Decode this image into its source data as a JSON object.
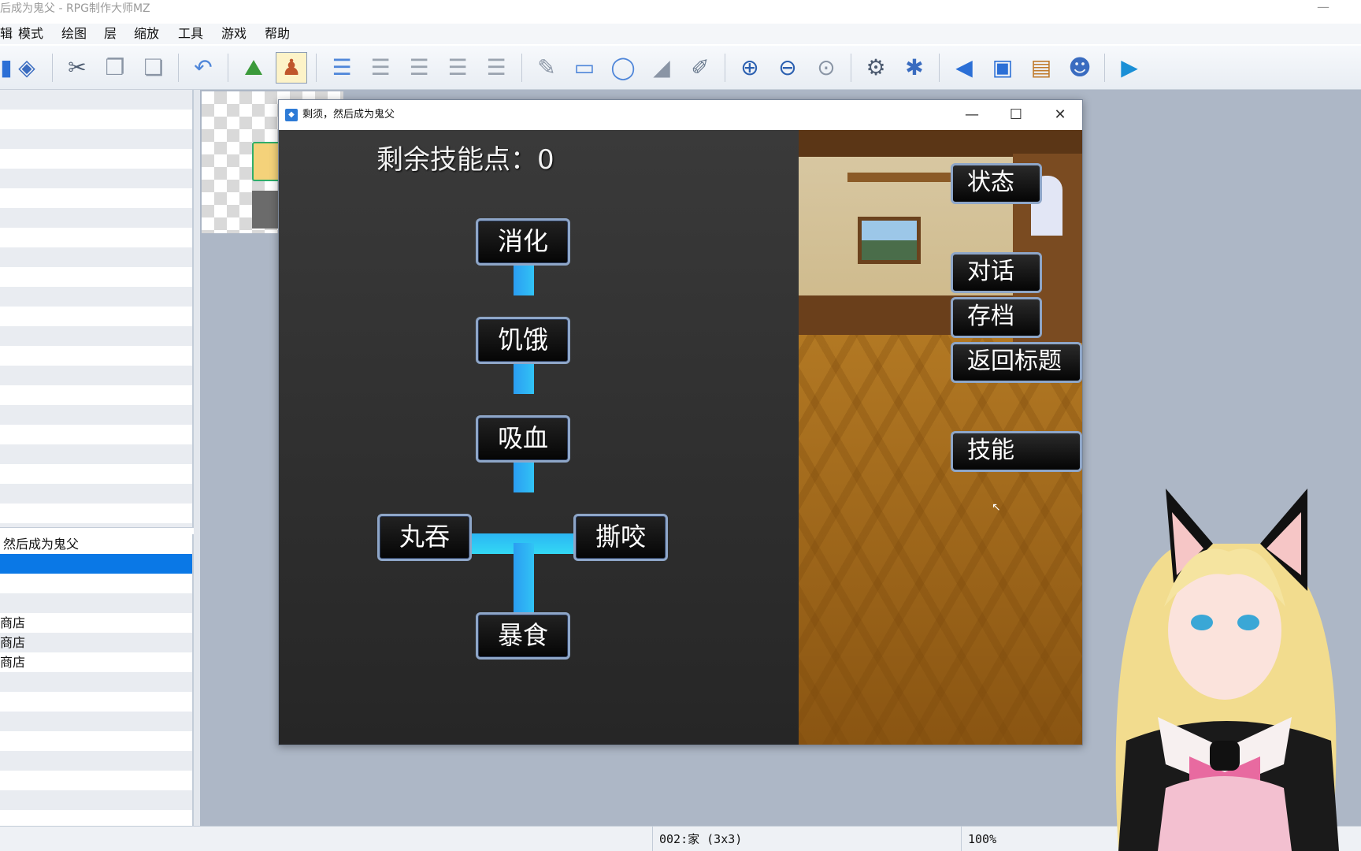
{
  "app": {
    "title": "后成为鬼父 - RPG制作大师MZ",
    "minimize_glyph": "—"
  },
  "menubar": {
    "items": [
      {
        "label": "辑"
      },
      {
        "label": "模式"
      },
      {
        "label": "绘图"
      },
      {
        "label": "层"
      },
      {
        "label": "缩放"
      },
      {
        "label": "工具"
      },
      {
        "label": "游戏"
      },
      {
        "label": "帮助"
      }
    ]
  },
  "toolbar": {
    "icons": [
      "save-icon",
      "deploy-icon",
      "cut-icon",
      "copy-icon",
      "paste-icon",
      "undo-icon",
      "map-mode-icon",
      "event-mode-icon",
      "layer-auto-icon",
      "layer-1-icon",
      "layer-2-icon",
      "layer-3-icon",
      "layer-4-icon",
      "pencil-icon",
      "rectangle-icon",
      "ellipse-icon",
      "fill-icon",
      "shadow-pen-icon",
      "zoom-in-icon",
      "zoom-out-icon",
      "zoom-actual-icon",
      "database-icon",
      "plugin-manager-icon",
      "sound-test-icon",
      "event-searcher-icon",
      "resource-manager-icon",
      "character-generator-icon",
      "playtest-icon"
    ]
  },
  "map_tree": {
    "project_label": "然后成为鬼父",
    "entries": [
      "商店",
      "商店",
      "商店"
    ]
  },
  "statusbar": {
    "map_info": "002:家 (3x3)",
    "zoom": "100%"
  },
  "game_window": {
    "title": "剩须，然后成为鬼父",
    "controls": {
      "minimize": "—",
      "maximize": "☐",
      "close": "✕"
    },
    "skill_points_label": "剩余技能点：0",
    "skill_tree": [
      {
        "id": "digest",
        "label": "消化"
      },
      {
        "id": "hunger",
        "label": "饥饿"
      },
      {
        "id": "bloodsuck",
        "label": "吸血"
      },
      {
        "id": "swallow",
        "label": "丸吞"
      },
      {
        "id": "bite",
        "label": "撕咬"
      },
      {
        "id": "gluttony",
        "label": "暴食"
      }
    ],
    "menu": [
      {
        "id": "status",
        "label": "状态"
      },
      {
        "id": "talk",
        "label": "对话"
      },
      {
        "id": "save",
        "label": "存档"
      },
      {
        "id": "title",
        "label": "返回标题"
      },
      {
        "id": "skills",
        "label": "技能"
      }
    ]
  },
  "colors": {
    "selection": "#0a78e6",
    "connector": "#2bb6f3",
    "node_border": "#8ea6c8",
    "map_background": "#adb7c6"
  }
}
